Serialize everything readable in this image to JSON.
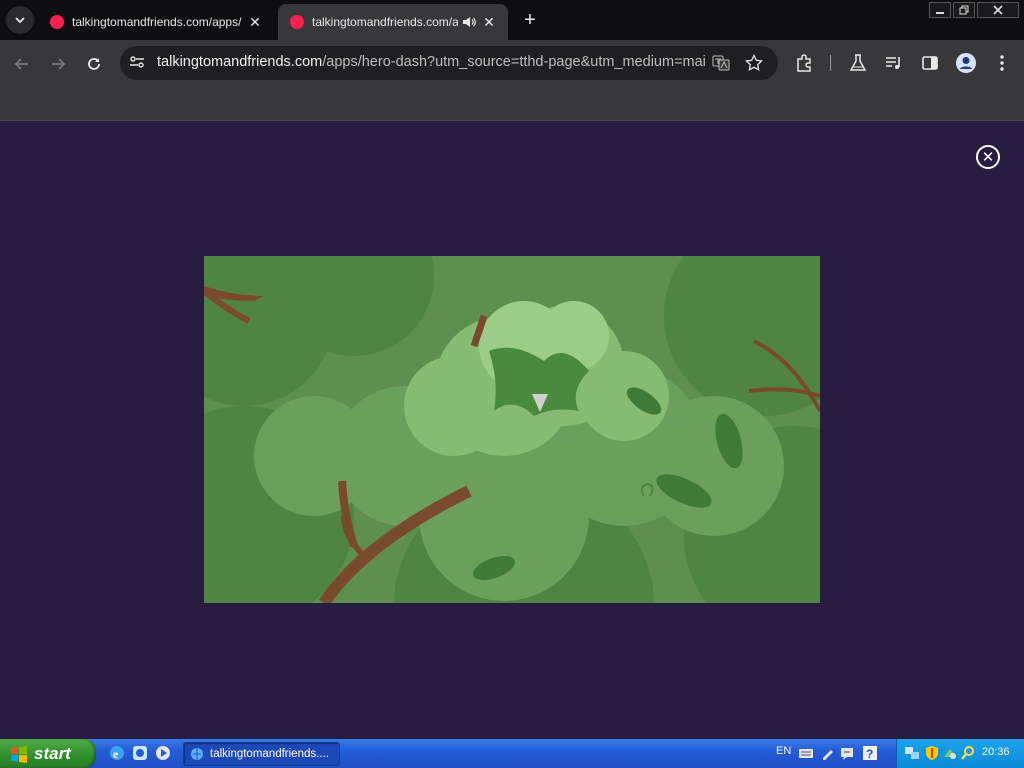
{
  "browser": {
    "tabs": [
      {
        "title": "talkingtomandfriends.com/apps/hero-dash",
        "active": false
      },
      {
        "title": "talkingtomandfriends.com/apps/hero-dash",
        "active": true,
        "audible": true
      }
    ],
    "url_host": "talkingtomandfriends.com",
    "url_path": "/apps/hero-dash?utm_source=tthd-page&utm_medium=mai..."
  },
  "page": {
    "background_color": "#281c40",
    "close_icon": "close-circle-icon",
    "game_scene": "forest-canopy"
  },
  "taskbar": {
    "start_label": "start",
    "task_label": "talkingtomandfriends....",
    "language": "EN",
    "clock": "20:36"
  },
  "colors": {
    "favicon": "#ff2050",
    "taskbar": "#245dd8",
    "start": "#2e8d2b"
  }
}
